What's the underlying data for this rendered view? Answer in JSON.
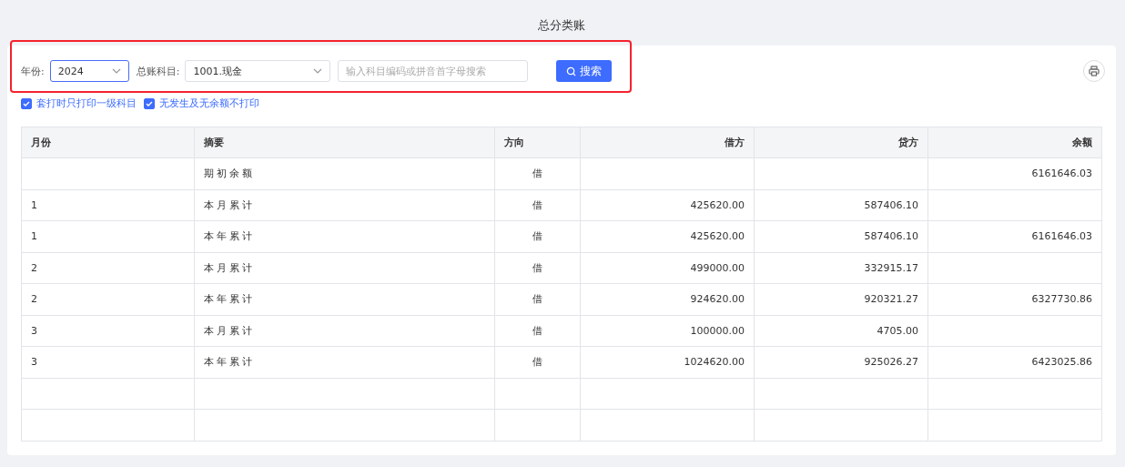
{
  "title": "总分类账",
  "filters": {
    "year_label": "年份:",
    "year": "2024",
    "subject_label": "总账科目:",
    "subject": "1001.现金",
    "search_placeholder": "输入科目编码或拼音首字母搜索",
    "search_button": "搜索"
  },
  "options": [
    {
      "label": "套打时只打印一级科目",
      "checked": true
    },
    {
      "label": "无发生及无余额不打印",
      "checked": true
    }
  ],
  "table": {
    "columns": [
      "月份",
      "摘要",
      "方向",
      "借方",
      "贷方",
      "余额"
    ],
    "rows": [
      {
        "month": "",
        "summary": "期初余额",
        "direction": "借",
        "debit": "",
        "credit": "",
        "balance": "6161646.03"
      },
      {
        "month": "1",
        "summary": "本月累计",
        "direction": "借",
        "debit": "425620.00",
        "credit": "587406.10",
        "balance": ""
      },
      {
        "month": "1",
        "summary": "本年累计",
        "direction": "借",
        "debit": "425620.00",
        "credit": "587406.10",
        "balance": "6161646.03"
      },
      {
        "month": "2",
        "summary": "本月累计",
        "direction": "借",
        "debit": "499000.00",
        "credit": "332915.17",
        "balance": ""
      },
      {
        "month": "2",
        "summary": "本年累计",
        "direction": "借",
        "debit": "924620.00",
        "credit": "920321.27",
        "balance": "6327730.86"
      },
      {
        "month": "3",
        "summary": "本月累计",
        "direction": "借",
        "debit": "100000.00",
        "credit": "4705.00",
        "balance": ""
      },
      {
        "month": "3",
        "summary": "本年累计",
        "direction": "借",
        "debit": "1024620.00",
        "credit": "925026.27",
        "balance": "6423025.86"
      },
      {},
      {}
    ]
  }
}
